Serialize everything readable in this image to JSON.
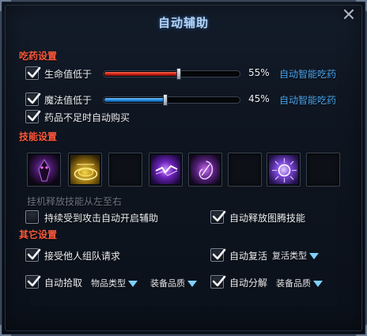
{
  "window": {
    "title": "自动辅助"
  },
  "colors": {
    "accent_section": "#ff5a3c",
    "link": "#4aa6f0",
    "hp_bar": "#e02a18",
    "mp_bar": "#2a8ae0"
  },
  "potion": {
    "section": "吃药设置",
    "hp": {
      "label": "生命值低于",
      "value": 0.55,
      "percent": "55%",
      "link": "自动智能吃药",
      "checked": true
    },
    "mp": {
      "label": "魔法值低于",
      "value": 0.45,
      "percent": "45%",
      "link": "自动智能吃药",
      "checked": true
    },
    "auto_buy": {
      "label": "药品不足时自动购买",
      "checked": true
    }
  },
  "skills": {
    "section": "技能设置",
    "slots": [
      {
        "icon": "dark-demon-skill-icon",
        "empty": false
      },
      {
        "icon": "golden-shield-skill-icon",
        "empty": false
      },
      {
        "icon": "empty-slot",
        "empty": true
      },
      {
        "icon": "purple-lightning-skill-icon",
        "empty": false
      },
      {
        "icon": "violet-whirl-skill-icon",
        "empty": false
      },
      {
        "icon": "empty-slot",
        "empty": true
      },
      {
        "icon": "arcane-burst-skill-icon",
        "empty": false
      },
      {
        "icon": "empty-slot",
        "empty": true
      }
    ],
    "hint": "挂机释放技能从左至右",
    "continuous_attack": {
      "label": "持续受到攻击自动开启辅助",
      "checked": false
    },
    "totem": {
      "label": "自动释放图腾技能",
      "checked": true
    }
  },
  "other": {
    "section": "其它设置",
    "accept_team": {
      "label": "接受他人组队请求",
      "checked": true
    },
    "auto_revive": {
      "label": "自动复活",
      "checked": true,
      "dropdown": "复活类型"
    },
    "auto_pickup": {
      "label": "自动拾取",
      "checked": true,
      "dropdown1": "物品类型",
      "dropdown2": "装备品质"
    },
    "auto_decompose": {
      "label": "自动分解",
      "checked": true,
      "dropdown": "装备品质"
    }
  }
}
